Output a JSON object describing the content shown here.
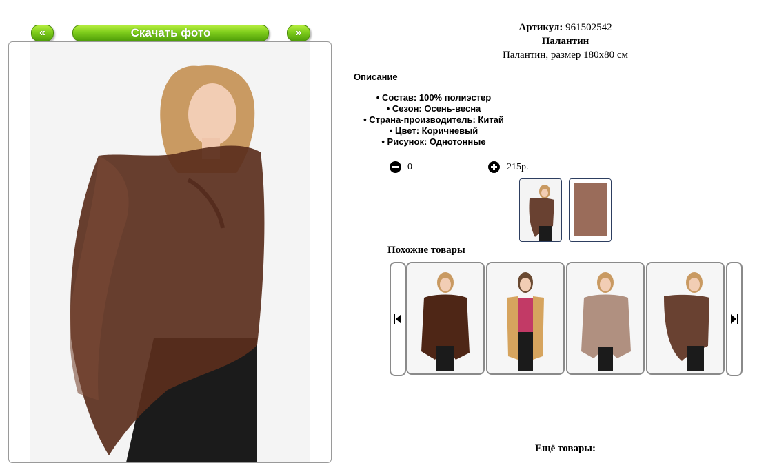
{
  "nav": {
    "prev_label": "«",
    "download_label": "Скачать фото",
    "next_label": "»"
  },
  "product": {
    "article_label": "Артикул:",
    "article_value": "961502542",
    "name": "Палантин",
    "subtitle": "Палантин, размер 180x80 см"
  },
  "description": {
    "title": "Описание",
    "items": [
      "• Состав: 100% полиэстер",
      "• Сезон: Осень-весна",
      "• Страна-производитель: Китай",
      "• Цвет: Коричневый",
      "• Рисунок: Однотонные"
    ]
  },
  "order": {
    "quantity": "0",
    "price": "215р."
  },
  "similar": {
    "title": "Похожие товары"
  },
  "more": {
    "title": "Ещё товары:"
  },
  "colors": {
    "scarf_brown": "#5a2e1c",
    "button_green": "#7fcd1c"
  }
}
